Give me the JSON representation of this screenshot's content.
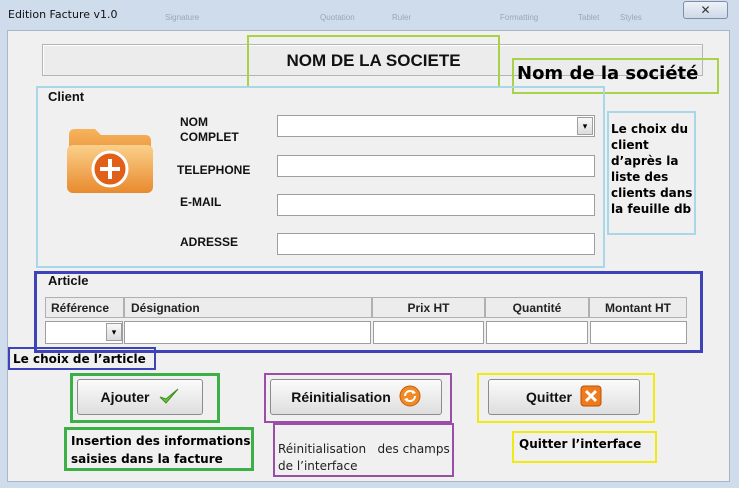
{
  "window": {
    "title": "Edition Facture v1.0",
    "close_glyph": "✕",
    "background_labels": [
      "Signature",
      "Quotation",
      "Ruler",
      "Formatting",
      "Tablet",
      "Styles"
    ]
  },
  "header": {
    "company_name": "NOM DE LA SOCIETE",
    "annotation": "Nom de la société"
  },
  "client": {
    "title": "Client",
    "icon": "folder-add-icon",
    "name_label_1": "NOM",
    "name_label_2": "COMPLET",
    "phone_label": "TELEPHONE",
    "email_label": "E-MAIL",
    "address_label": "ADRESSE",
    "name_value": "",
    "phone_value": "",
    "email_value": "",
    "address_value": "",
    "dropdown_arrow": "▾",
    "annotation_lines": [
      "Le choix du",
      "client",
      "d’après la",
      "liste des",
      "clients dans",
      "la feuille db"
    ]
  },
  "article": {
    "title": "Article",
    "columns": [
      "Référence",
      "Désignation",
      "Prix HT",
      "Quantité",
      "Montant HT"
    ],
    "dropdown_arrow": "▾",
    "annotation": "Le choix de l’article"
  },
  "buttons": {
    "add_label": "Ajouter",
    "add_icon": "checkmark-icon",
    "reset_label": "Réinitialisation",
    "reset_icon": "refresh-icon",
    "quit_label": "Quitter",
    "quit_icon": "close-box-icon"
  },
  "annotations": {
    "add_lines": [
      "Insertion des informations",
      "saisies dans la facture"
    ],
    "reset_lines": [
      "Réinitialisation   des champs",
      "de l’interface"
    ],
    "quit": "Quitter l’interface"
  },
  "colors": {
    "green": "#3cb046",
    "lime": "#a9d24a",
    "cyan": "#a8d8e8",
    "blue": "#3e43b8",
    "purple": "#9b4ea8",
    "yellow": "#f0ea14"
  }
}
